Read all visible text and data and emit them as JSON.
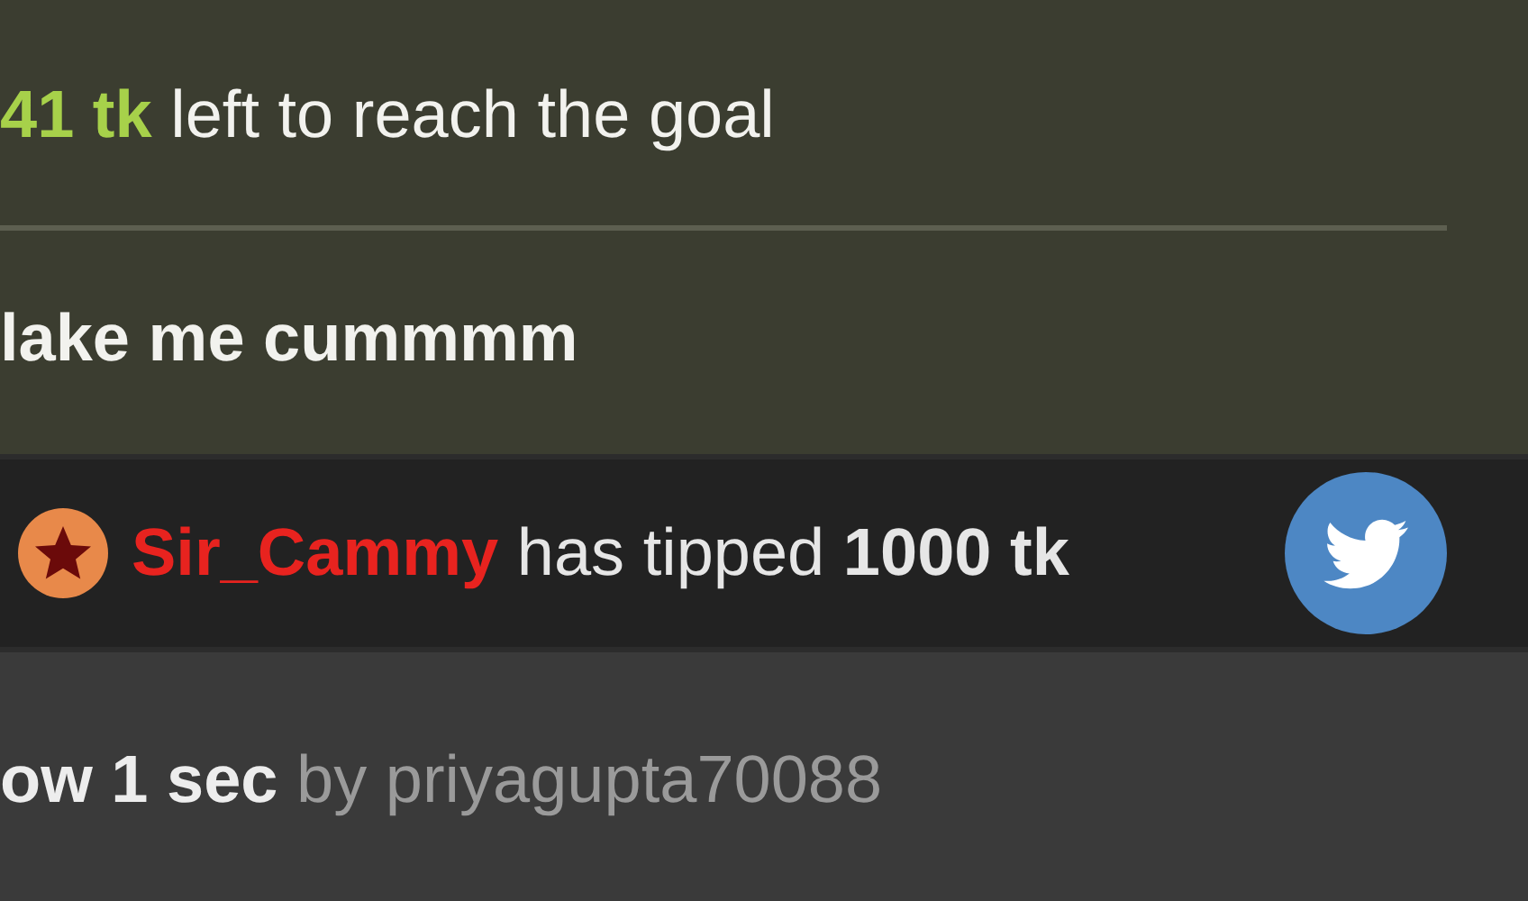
{
  "goal": {
    "amount": "41 tk",
    "text": "left to reach the goal"
  },
  "subject": "lake me cummmm",
  "tip": {
    "user": "Sir_Cammy",
    "text": "has tipped",
    "amount": "1000 tk"
  },
  "meta": {
    "time": "ow 1 sec",
    "by": "by priyagupta70088"
  }
}
